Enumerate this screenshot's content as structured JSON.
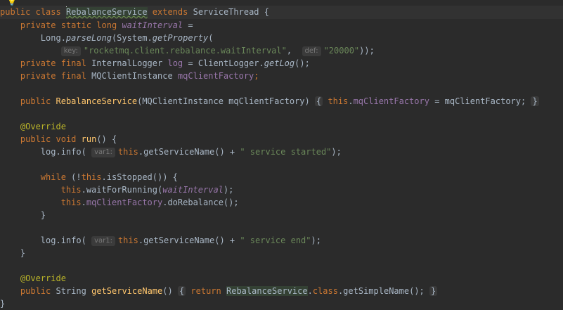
{
  "code": {
    "l1": {
      "kw1": "public",
      "kw2": "class",
      "name": "RebalanceService",
      "kw3": "extends",
      "sup": "ServiceThread",
      "brace": "{"
    },
    "l2": {
      "kw1": "private",
      "kw2": "static",
      "kw3": "long",
      "field": "waitInterval",
      "eq": "="
    },
    "l3": {
      "a": "Long.",
      "fn": "parseLong",
      "b": "(System.",
      "fn2": "getProperty",
      "c": "("
    },
    "l4": {
      "hint_key": "key:",
      "str1": "\"rocketmq.client.rebalance.waitInterval\"",
      "comma": ",",
      "hint_def": "def:",
      "str2": "\"20000\"",
      "end": "));"
    },
    "l5": {
      "kw1": "private",
      "kw2": "final",
      "type": "InternalLogger",
      "field": "log",
      "rest": "= ClientLogger.",
      "fn": "getLog",
      "end": "();"
    },
    "l6": {
      "kw1": "private",
      "kw2": "final",
      "type": "MQClientInstance",
      "field": "mqClientFactory",
      "end": ";"
    },
    "l7": {
      "kw1": "public",
      "fn": "RebalanceService",
      "params": "(MQClientInstance mqClientFactory)",
      "fold_open": "{",
      "kw_this": "this",
      "field": "mqClientFactory",
      "assign": "= mqClientFactory;",
      "fold_close": "}"
    },
    "l8": {
      "ann": "@Override"
    },
    "l9": {
      "kw1": "public",
      "kw2": "void",
      "fn": "run",
      "rest": "() {"
    },
    "l10": {
      "a": "log.info(",
      "hint": "var1:",
      "kw_this": "this",
      "b": ".getServiceName() + ",
      "str": "\" service started\"",
      "end": ");"
    },
    "l11": {
      "kw": "while",
      "a": "(!",
      "kw_this": "this",
      "b": ".isStopped()) {"
    },
    "l12": {
      "kw_this": "this",
      "a": ".waitForRunning(",
      "field": "waitInterval",
      "end": ");"
    },
    "l13": {
      "kw_this": "this",
      "dot": ".",
      "field": "mqClientFactory",
      "rest": ".doRebalance();"
    },
    "l14": {
      "brace": "}"
    },
    "l15": {
      "a": "log.info(",
      "hint": "var1:",
      "kw_this": "this",
      "b": ".getServiceName() + ",
      "str": "\" service end\"",
      "end": ");"
    },
    "l16": {
      "brace": "}"
    },
    "l17": {
      "ann": "@Override"
    },
    "l18": {
      "kw1": "public",
      "type": "String",
      "fn": "getServiceName",
      "paren": "()",
      "fold_open": "{",
      "kw_ret": "return",
      "cls": "RebalanceService",
      "dot": ".",
      "kw_class": "class",
      "rest": ".getSimpleName();",
      "fold_close": "}"
    },
    "l19": {
      "brace": "}"
    }
  },
  "icons": {
    "lightbulb": "lightbulb-icon"
  },
  "colors": {
    "background": "#2b2b2b",
    "keyword": "#cc7832",
    "field": "#9876aa",
    "string": "#6a8759",
    "method": "#ffc66d",
    "annotation": "#bbb529"
  }
}
